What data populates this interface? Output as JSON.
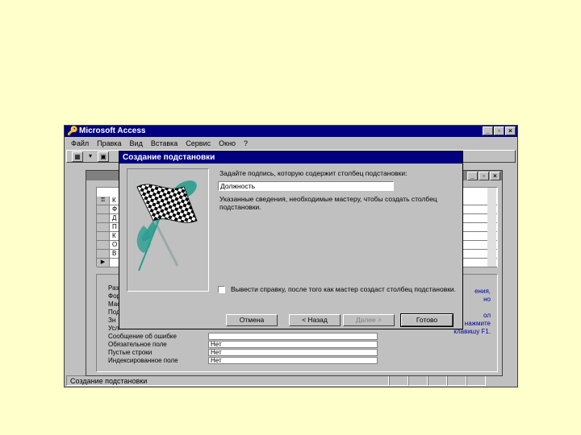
{
  "app": {
    "title": "Microsoft Access",
    "menu": [
      "Файл",
      "Правка",
      "Вид",
      "Вставка",
      "Сервис",
      "Окно",
      "?"
    ],
    "status": "Создание подстановки"
  },
  "table_window": {
    "rows": [
      {
        "sel": "⚿",
        "text": "К"
      },
      {
        "sel": "",
        "text": "Ф"
      },
      {
        "sel": "",
        "text": "Д"
      },
      {
        "sel": "",
        "text": "П"
      },
      {
        "sel": "",
        "text": "К"
      },
      {
        "sel": "",
        "text": "О"
      },
      {
        "sel": "",
        "text": "В"
      },
      {
        "sel": "▶",
        "text": ""
      }
    ],
    "properties": [
      {
        "label": "Раз",
        "value": ""
      },
      {
        "label": "Фор",
        "value": ""
      },
      {
        "label": "Мас",
        "value": ""
      },
      {
        "label": "Под",
        "value": ""
      },
      {
        "label": "Зн",
        "value": ""
      },
      {
        "label": "Усл",
        "value": ""
      },
      {
        "label": "Сообщение об ошибке",
        "value": ""
      },
      {
        "label": "Обязательное поле",
        "value": "Нет"
      },
      {
        "label": "Пустые строки",
        "value": "Нет"
      },
      {
        "label": "Индексированное поле",
        "value": "Нет"
      }
    ],
    "hint_lines": [
      "ения,",
      "но",
      "",
      "ол",
      "ипов данных нажмите",
      "клавишу F1."
    ]
  },
  "wizard": {
    "title": "Создание подстановки",
    "question": "Задайте подпись, которую содержит столбец подстановки:",
    "answer": "Должность",
    "info": "Указанные сведения, необходимые мастеру, чтобы создать столбец подстановки.",
    "help_checkbox": "Вывести справку, после того как мастер создаст столбец подстановки.",
    "buttons": {
      "cancel": "Отмена",
      "back": "< Назад",
      "next": "Далее >",
      "finish": "Готово"
    }
  },
  "colors": {
    "desktop": "#ffffcc",
    "title_active": "#000080",
    "face": "#c0c0c0",
    "flag_teal": "#2a9d8f"
  }
}
